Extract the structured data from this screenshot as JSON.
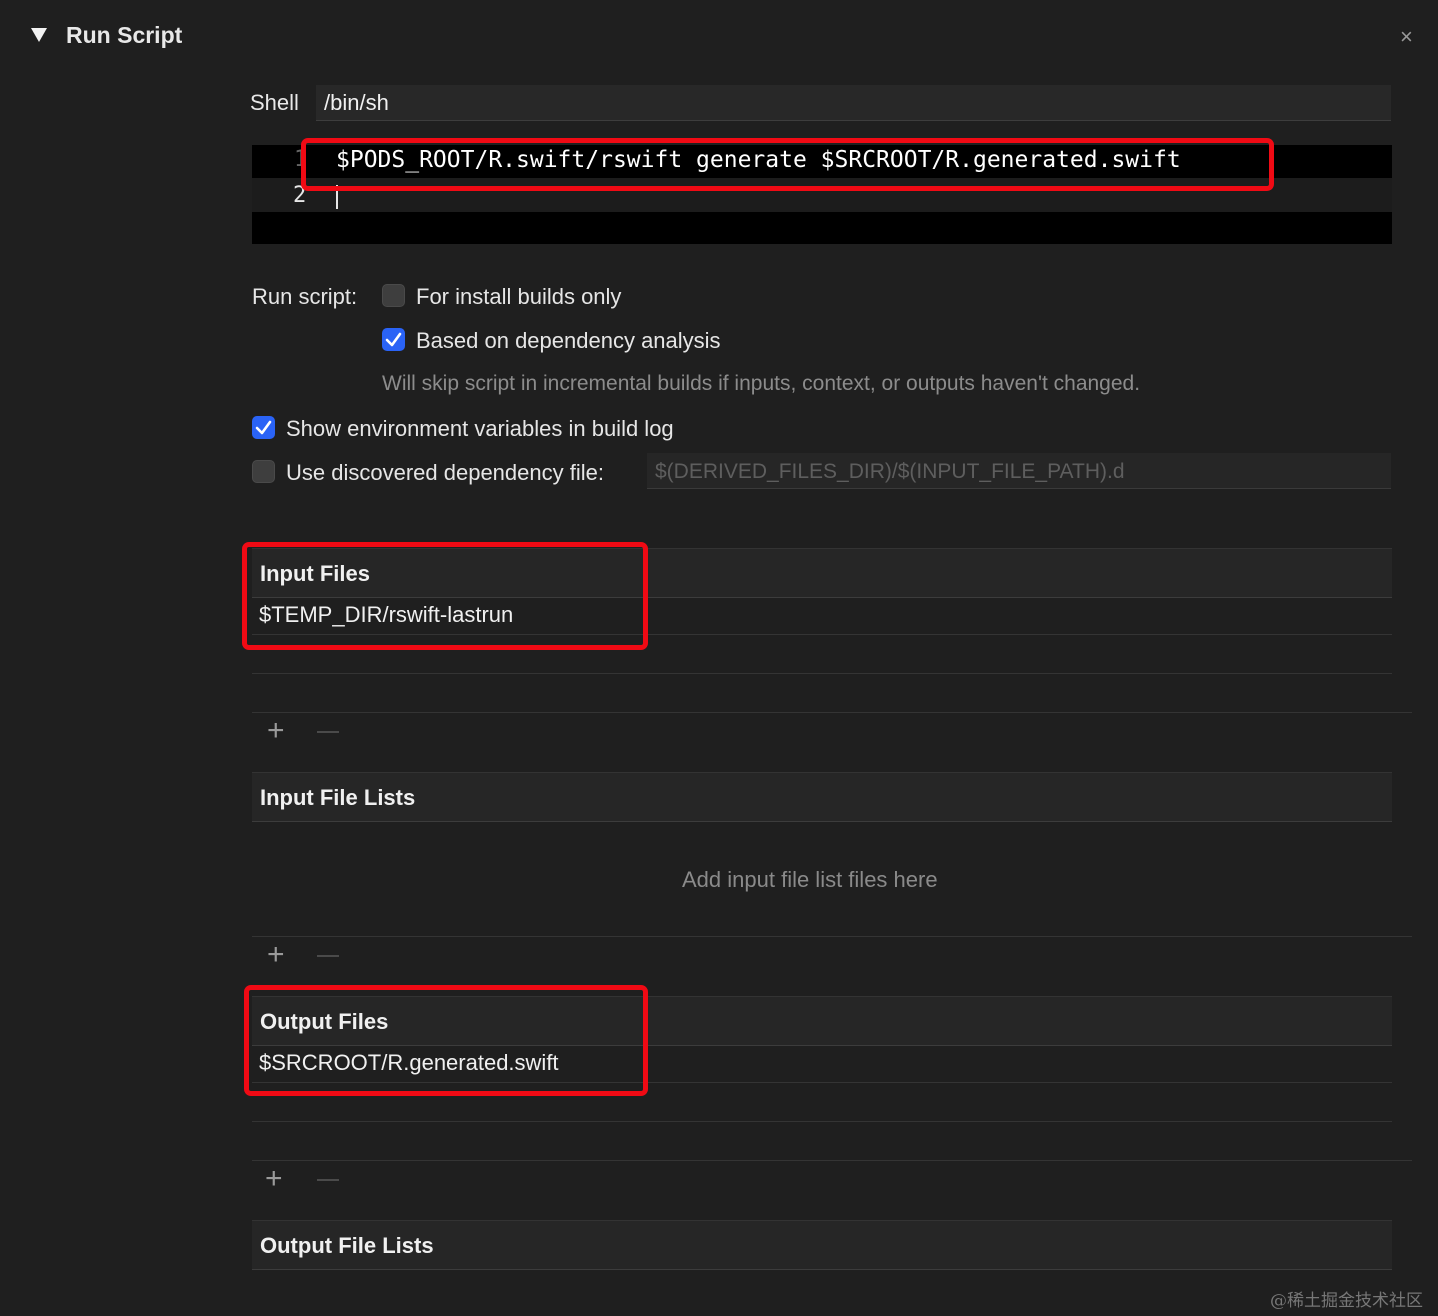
{
  "header": {
    "title": "Run Script",
    "close_glyph": "×",
    "disclosure_icon": "triangle-down-icon"
  },
  "shell": {
    "label": "Shell",
    "value": "/bin/sh"
  },
  "editor": {
    "lines": [
      {
        "number": "1",
        "code": "$PODS_ROOT/R.swift/rswift generate $SRCROOT/R.generated.swift"
      },
      {
        "number": "2",
        "code": ""
      }
    ]
  },
  "options": {
    "run_script_label": "Run script:",
    "install_builds_only": {
      "label": "For install builds only",
      "checked": false
    },
    "dependency_analysis": {
      "label": "Based on dependency analysis",
      "checked": true
    },
    "dependency_note": "Will skip script in incremental builds if inputs, context, or outputs haven't changed.",
    "show_env_vars": {
      "label": "Show environment variables in build log",
      "checked": true
    },
    "use_dep_file": {
      "label": "Use discovered dependency file:",
      "checked": false
    },
    "dep_file_placeholder": "$(DERIVED_FILES_DIR)/$(INPUT_FILE_PATH).d"
  },
  "input_files": {
    "header": "Input Files",
    "rows": [
      "$TEMP_DIR/rswift-lastrun"
    ]
  },
  "input_file_lists": {
    "header": "Input File Lists",
    "placeholder": "Add input file list files here"
  },
  "output_files": {
    "header": "Output Files",
    "rows": [
      "$SRCROOT/R.generated.swift"
    ]
  },
  "output_file_lists": {
    "header": "Output File Lists"
  },
  "controls": {
    "add_glyph": "+"
  },
  "colors": {
    "background": "#1f1f1f",
    "checkbox_on": "#2a63f6",
    "highlight": "#f00a14"
  },
  "watermark": "@稀土掘金技术社区"
}
